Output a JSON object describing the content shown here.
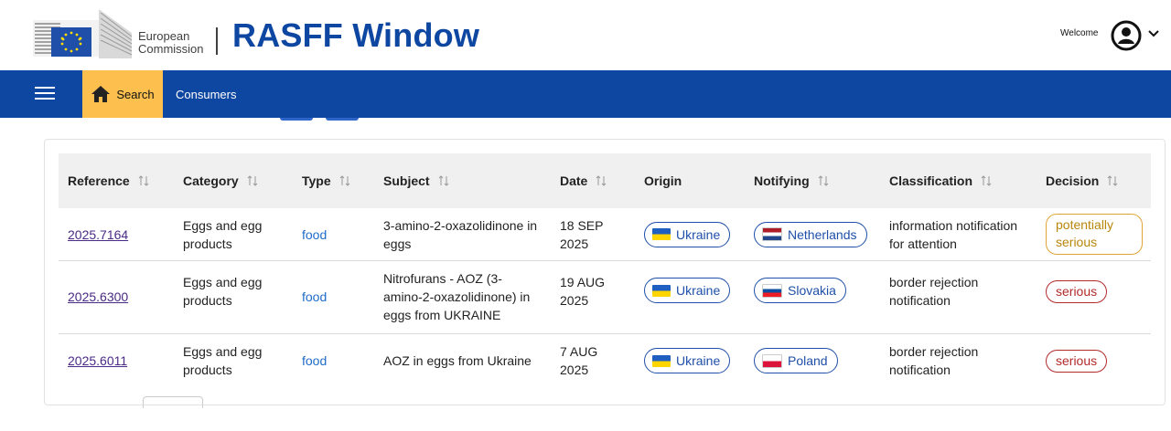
{
  "header": {
    "org_line1": "European",
    "org_line2": "Commission",
    "app_title": "RASFF Window",
    "welcome": "Welcome"
  },
  "nav": {
    "search_label": "Search",
    "consumers_label": "Consumers"
  },
  "table": {
    "columns": [
      "Reference",
      "Category",
      "Type",
      "Subject",
      "Date",
      "Origin",
      "Notifying",
      "Classification",
      "Decision"
    ],
    "rows": [
      {
        "reference": "2025.7164",
        "category_l1": "Eggs and egg",
        "category_l2": "products",
        "type": "food",
        "subject_l1": "3-amino-2-oxazolidinone in",
        "subject_l2": "eggs",
        "subject_l3": "",
        "date_l1": "18 SEP",
        "date_l2": "2025",
        "origin": "Ukraine",
        "notifying": "Netherlands",
        "classification_l1": "information notification",
        "classification_l2": "for attention",
        "decision_l1": "potentially",
        "decision_l2": "serious"
      },
      {
        "reference": "2025.6300",
        "category_l1": "Eggs and egg",
        "category_l2": "products",
        "type": "food",
        "subject_l1": "Nitrofurans - AOZ (3-",
        "subject_l2": "amino-2-oxazolidinone) in",
        "subject_l3": "eggs from UKRAINE",
        "date_l1": "19 AUG",
        "date_l2": "2025",
        "origin": "Ukraine",
        "notifying": "Slovakia",
        "classification_l1": "border rejection",
        "classification_l2": "notification",
        "decision_l1": "serious",
        "decision_l2": ""
      },
      {
        "reference": "2025.6011",
        "category_l1": "Eggs and egg",
        "category_l2": "products",
        "type": "food",
        "subject_l1": "AOZ in eggs from Ukraine",
        "subject_l2": "",
        "subject_l3": "",
        "date_l1": "7 AUG",
        "date_l2": "2025",
        "origin": "Ukraine",
        "notifying": "Poland",
        "classification_l1": "border rejection",
        "classification_l2": "notification",
        "decision_l1": "serious",
        "decision_l2": ""
      }
    ]
  },
  "colors": {
    "brand_blue": "#0e47a1",
    "search_tab": "#fdbf4e",
    "link_purple": "#4a2a85",
    "food_link": "#1f6bc9",
    "serious": "#b22b2b",
    "potentially_serious": "#e0a437"
  },
  "icons": {
    "menu": "hamburger-icon",
    "home": "home-icon",
    "avatar": "user-circle-icon",
    "chevron": "chevron-down-icon",
    "sort": "sort-arrows-icon"
  }
}
